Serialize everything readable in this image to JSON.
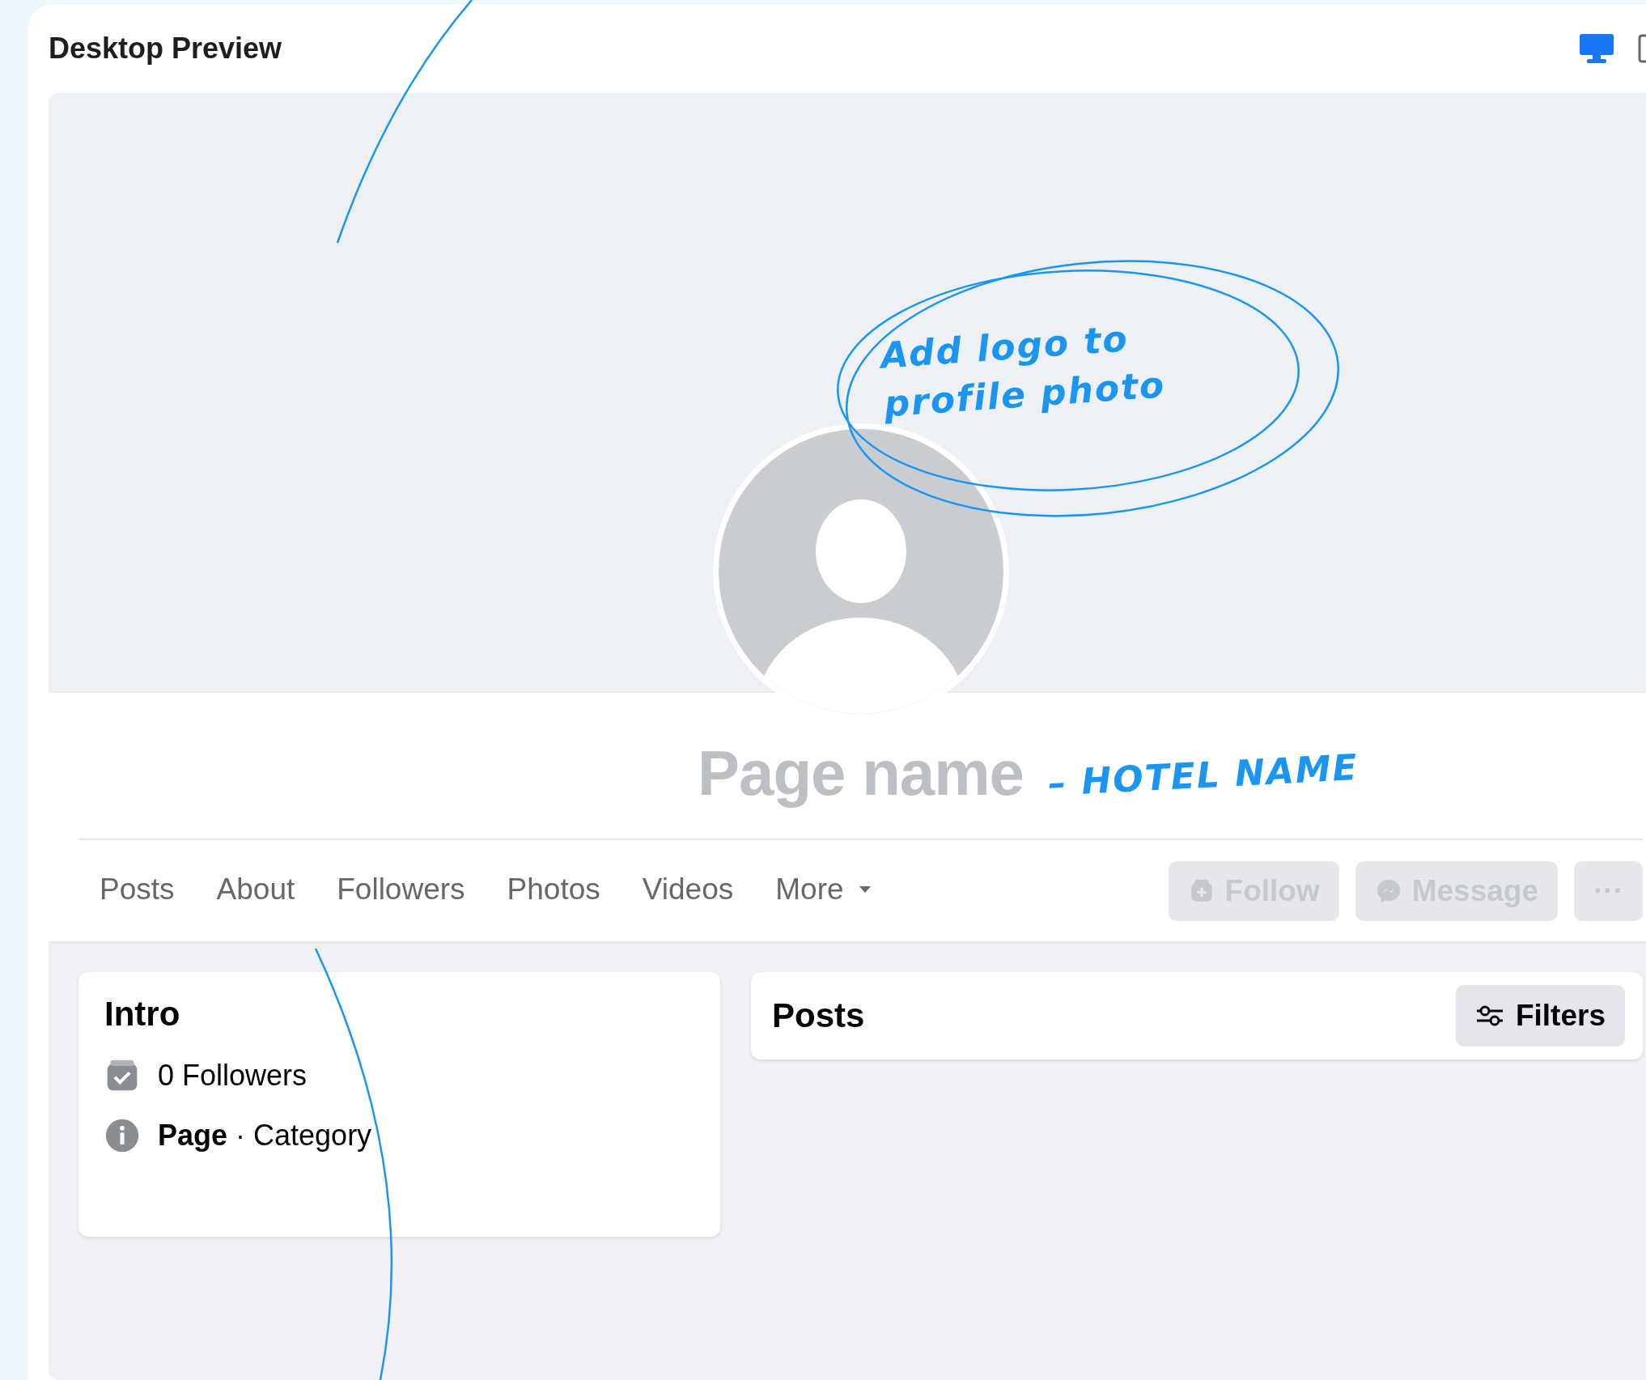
{
  "window": {
    "title": "Desktop Preview"
  },
  "preview": {
    "page_name": "Page name",
    "tabs": [
      {
        "label": "Posts",
        "selected": false,
        "kind": "link"
      },
      {
        "label": "About",
        "selected": false,
        "kind": "link"
      },
      {
        "label": "Followers",
        "selected": false,
        "kind": "link"
      },
      {
        "label": "Photos",
        "selected": false,
        "kind": "link"
      },
      {
        "label": "Videos",
        "selected": false,
        "kind": "link"
      },
      {
        "label": "More",
        "selected": false,
        "kind": "dropdown"
      }
    ],
    "actions": [
      {
        "kind": "follow",
        "label": "Follow",
        "disabled": true
      },
      {
        "kind": "message",
        "label": "Message",
        "disabled": true
      },
      {
        "kind": "more",
        "label": "···",
        "disabled": true
      }
    ],
    "intro": {
      "title": "Intro",
      "items": [
        {
          "kind": "followers",
          "text": "0 Followers"
        },
        {
          "kind": "info",
          "text": "**Page** · Category"
        }
      ]
    },
    "posts": {
      "title": "Posts",
      "filter_button": "Filters"
    }
  },
  "annotations": [
    {
      "kind": "circled",
      "text": "Add logo to profile photo"
    },
    {
      "kind": "pointer",
      "text": "– HOTEL NAME"
    }
  ]
}
